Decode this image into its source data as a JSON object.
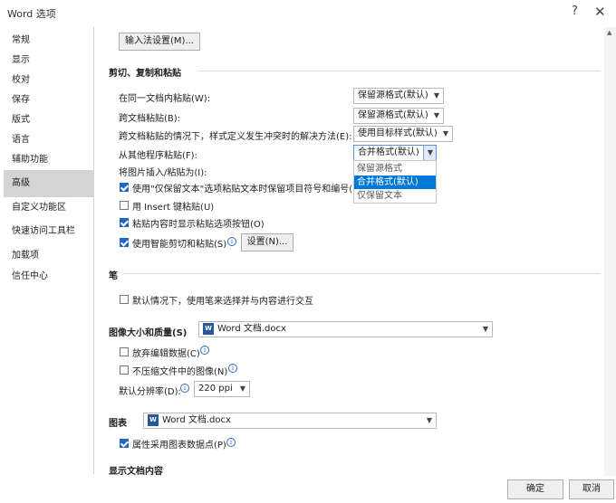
{
  "window": {
    "title": "Word 选项",
    "help": "?",
    "close": "✕"
  },
  "sidebar": {
    "items": [
      {
        "label": "常规"
      },
      {
        "label": "显示"
      },
      {
        "label": "校对"
      },
      {
        "label": "保存"
      },
      {
        "label": "版式"
      },
      {
        "label": "语言"
      },
      {
        "label": "辅助功能"
      },
      {
        "label": "高级"
      },
      {
        "label": "自定义功能区"
      },
      {
        "label": "快速访问工具栏"
      },
      {
        "label": "加载项"
      },
      {
        "label": "信任中心"
      }
    ],
    "selected": "高级"
  },
  "ime_button": "输入法设置(M)...",
  "cutcopy": {
    "heading": "剪切、复制和粘贴",
    "rows": [
      {
        "label": "在同一文档内粘贴(W):",
        "value": "保留源格式(默认)"
      },
      {
        "label": "跨文档粘贴(B):",
        "value": "保留源格式(默认)"
      },
      {
        "label": "跨文档粘贴的情况下，样式定义发生冲突时的解决方法(E):",
        "value": "使用目标样式(默认)"
      },
      {
        "label": "从其他程序粘贴(F):",
        "value": "合并格式(默认)"
      },
      {
        "label": "将图片插入/粘贴为(I):",
        "value": ""
      }
    ],
    "dropdown_options": [
      "保留源格式",
      "合并格式(默认)",
      "仅保留文本"
    ],
    "dropdown_selected": 1,
    "checks": [
      {
        "label": "使用\"仅保留文本\"选项粘贴文本时保留项目符号和编号(L)",
        "checked": true
      },
      {
        "label": "用 Insert 键粘贴(U)",
        "checked": false
      },
      {
        "label": "粘贴内容时显示粘贴选项按钮(O)",
        "checked": true
      },
      {
        "label": "使用智能剪切和粘贴(S)",
        "checked": true
      }
    ],
    "settings_button": "设置(N)..."
  },
  "pen": {
    "heading": "笔",
    "check": {
      "label": "默认情况下，使用笔来选择并与内容进行交互",
      "checked": false
    }
  },
  "image": {
    "heading": "图像大小和质量(S)",
    "doc": "Word 文档.docx",
    "checks": [
      {
        "label": "放弃编辑数据(C)",
        "checked": false
      },
      {
        "label": "不压缩文件中的图像(N)",
        "checked": false
      }
    ],
    "resolution_label": "默认分辨率(D):",
    "resolution_value": "220 ppi"
  },
  "chart": {
    "heading": "图表",
    "doc": "Word 文档.docx",
    "check": {
      "label": "属性采用图表数据点(P)",
      "checked": true
    }
  },
  "display": {
    "heading": "显示文档内容"
  },
  "footer": {
    "ok": "确定",
    "cancel": "取消"
  },
  "icons": {
    "info": "i",
    "word_doc": "W"
  }
}
